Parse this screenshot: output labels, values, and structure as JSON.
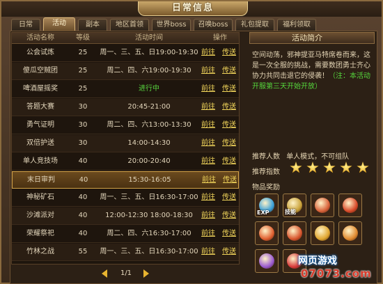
{
  "window": {
    "title": "日常信息"
  },
  "tabs": [
    {
      "label": "日常"
    },
    {
      "label": "活动",
      "active": true
    },
    {
      "label": "副本"
    },
    {
      "label": "地区首领"
    },
    {
      "label": "世界boss"
    },
    {
      "label": "召唤boss"
    },
    {
      "label": "礼包提取"
    },
    {
      "label": "福利领取"
    }
  ],
  "table": {
    "headers": {
      "name": "活动名称",
      "level": "等级",
      "time": "活动时间",
      "action": "操作"
    },
    "rows": [
      {
        "name": "公会试炼",
        "level": "25",
        "time": "周一、三、五、日19:00-19:30",
        "go": "前往",
        "teleport": "传送"
      },
      {
        "name": "傻瓜空贼团",
        "level": "25",
        "time": "周二、四、六19:00-19:30",
        "go": "前往",
        "teleport": "传送"
      },
      {
        "name": "啤酒屋摇奖",
        "level": "25",
        "time": "进行中",
        "go": "前往",
        "teleport": "传送",
        "status": true
      },
      {
        "name": "答题大赛",
        "level": "30",
        "time": "20:45-21:00",
        "go": "前往",
        "teleport": "传送"
      },
      {
        "name": "勇气证明",
        "level": "30",
        "time": "周二、四、六13:00-13:30",
        "go": "前往",
        "teleport": "传送"
      },
      {
        "name": "双倍护送",
        "level": "30",
        "time": "14:00-14:30",
        "go": "前往",
        "teleport": "传送"
      },
      {
        "name": "单人竞技场",
        "level": "40",
        "time": "20:00-20:40",
        "go": "前往",
        "teleport": "传送"
      },
      {
        "name": "末日审判",
        "level": "40",
        "time": "15:30-16:05",
        "go": "前往",
        "teleport": "传送",
        "selected": true
      },
      {
        "name": "神秘矿石",
        "level": "40",
        "time": "周一、三、五、日16:30-17:00",
        "go": "前往",
        "teleport": "传送"
      },
      {
        "name": "沙滩派对",
        "level": "40",
        "time": "12:00-12:30 18:00-18:30",
        "go": "前往",
        "teleport": "传送"
      },
      {
        "name": "荣耀祭祀",
        "level": "40",
        "time": "周二、四、六16:30-17:00",
        "go": "前往",
        "teleport": "传送"
      },
      {
        "name": "竹林之战",
        "level": "55",
        "time": "周一、三、五、日16:30-17:00",
        "go": "前往",
        "teleport": "传送"
      }
    ]
  },
  "pager": {
    "text": "1/1"
  },
  "info": {
    "title": "活动简介",
    "body": "空间动荡，邪神提亚马特席卷而来，这是一次全服的挑战，需要数团勇士齐心协力共同击退它的侵袭！",
    "note": "（注：本活动开服第三天开始开放）",
    "recommend_players_label": "推荐人数",
    "recommend_players_value": "单人模式，不可组队",
    "recommend_index_label": "推荐指数",
    "stars": 5,
    "rewards_label": "物品奖励"
  },
  "rewards": [
    {
      "icon": "exp-potion-icon",
      "tag": "EXP",
      "color": "#3aa0d8"
    },
    {
      "icon": "skill-book-icon",
      "tag": "技能",
      "color": "#c9a23a"
    },
    {
      "icon": "pet-egg-icon",
      "tag": "",
      "color": "#d8623a"
    },
    {
      "icon": "mushroom-icon",
      "tag": "",
      "color": "#d84a2a"
    },
    {
      "icon": "red-mushroom-icon",
      "tag": "",
      "color": "#e06030"
    },
    {
      "icon": "red-gift-icon",
      "tag": "",
      "color": "#d8562e"
    },
    {
      "icon": "gold-gift-icon",
      "tag": "",
      "color": "#e0a630"
    },
    {
      "icon": "orange-gift-icon",
      "tag": "",
      "color": "#e08a30"
    },
    {
      "icon": "pouch-icon",
      "tag": "",
      "color": "#9a5ad0"
    },
    {
      "icon": "gift-box-icon",
      "tag": "",
      "color": "#d83a3a"
    }
  ],
  "watermark": {
    "line1": "网页游戏",
    "line2": "07073.com"
  }
}
